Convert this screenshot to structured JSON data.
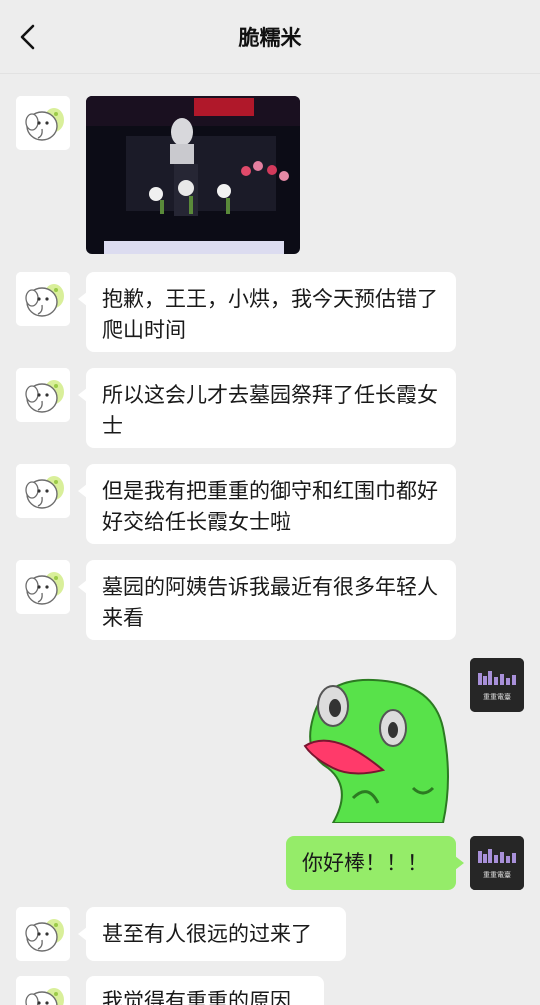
{
  "header": {
    "title": "脆糯米"
  },
  "messages": [
    {
      "side": "left",
      "type": "image",
      "description": "memorial-photo"
    },
    {
      "side": "left",
      "type": "text",
      "text": "抱歉，王王，小烘，我今天预估错了爬山时间"
    },
    {
      "side": "left",
      "type": "text",
      "text": "所以这会儿才去墓园祭拜了任长霞女士"
    },
    {
      "side": "left",
      "type": "text",
      "text": "但是我有把重重的御守和红围巾都好好交给任长霞女士啦"
    },
    {
      "side": "left",
      "type": "text",
      "text": "墓园的阿姨告诉我最近有很多年轻人来看"
    },
    {
      "side": "right",
      "type": "sticker",
      "description": "crying-frog-sticker"
    },
    {
      "side": "right",
      "type": "text",
      "text": "你好棒！！！"
    },
    {
      "side": "left",
      "type": "text",
      "text": "甚至有人很远的过来了"
    },
    {
      "side": "left",
      "type": "text",
      "text": "我觉得有重重的原因"
    }
  ],
  "avatars": {
    "right_label": "重重電臺"
  },
  "colors": {
    "background": "#ededed",
    "right_bubble": "#95ec69",
    "left_bubble": "#ffffff"
  }
}
